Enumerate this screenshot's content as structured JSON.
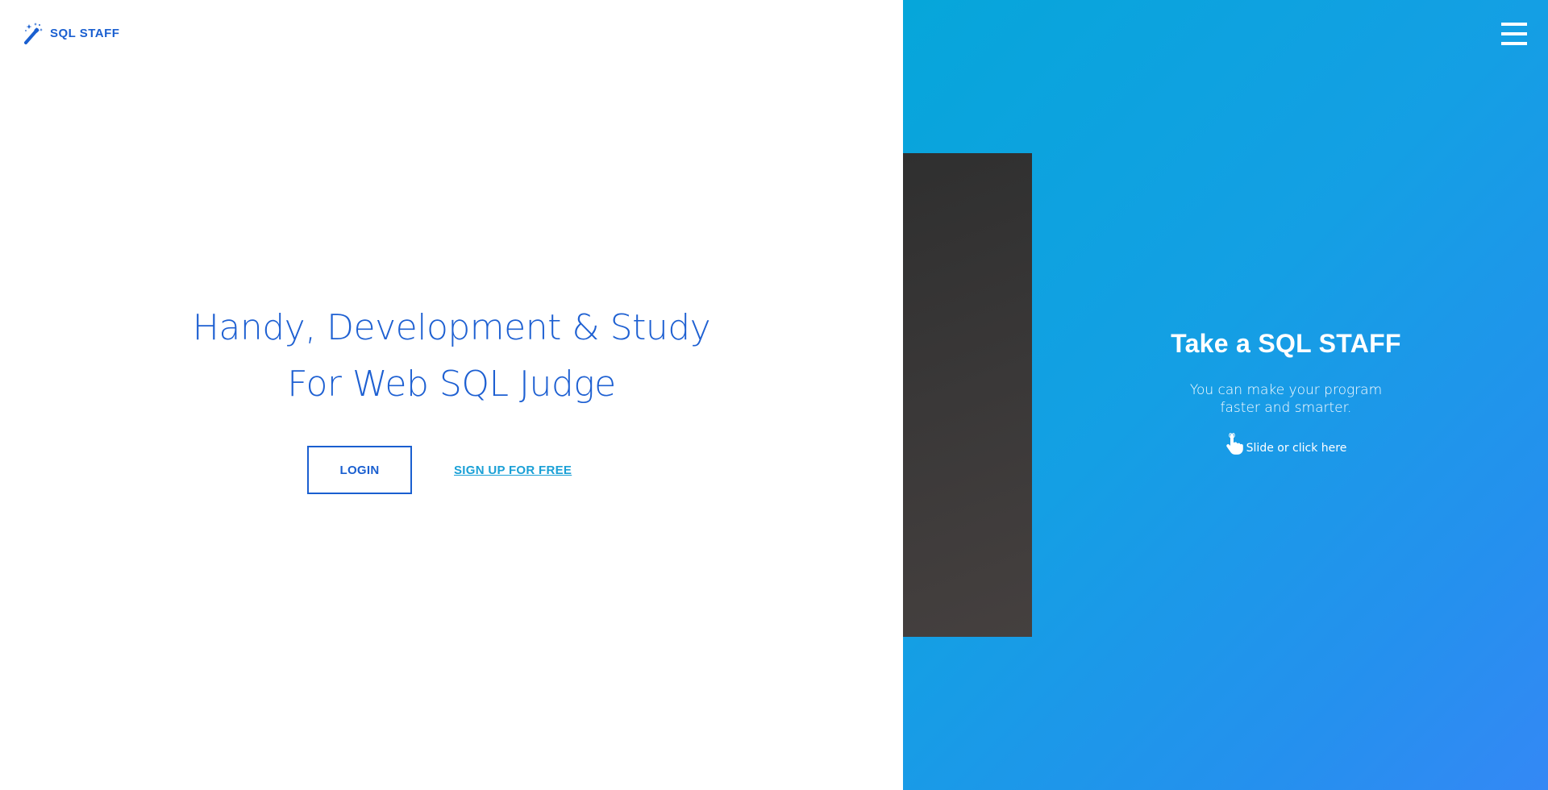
{
  "brand": {
    "name": "SQL STAFF",
    "icon": "magic-wand-icon",
    "color": "#1a5fd0"
  },
  "hero": {
    "line1": "Handy, Development & Study",
    "line2": "For Web SQL Judge"
  },
  "actions": {
    "login_label": "LOGIN",
    "signup_label": "SIGN UP FOR FREE"
  },
  "menu": {
    "icon": "hamburger-menu-icon"
  },
  "promo": {
    "title": "Take a SQL STAFF",
    "description_line1": "You can make your program",
    "description_line2": "faster and smarter.",
    "slide_label": "Slide or click here",
    "slide_icon": "pointing-hand-icon"
  },
  "colors": {
    "primary_blue": "#1e60d2",
    "link_blue": "#1aa0d6",
    "panel_gradient_start": "#06a6da",
    "panel_gradient_end": "#3488f5",
    "dark_slab": "#333333"
  }
}
